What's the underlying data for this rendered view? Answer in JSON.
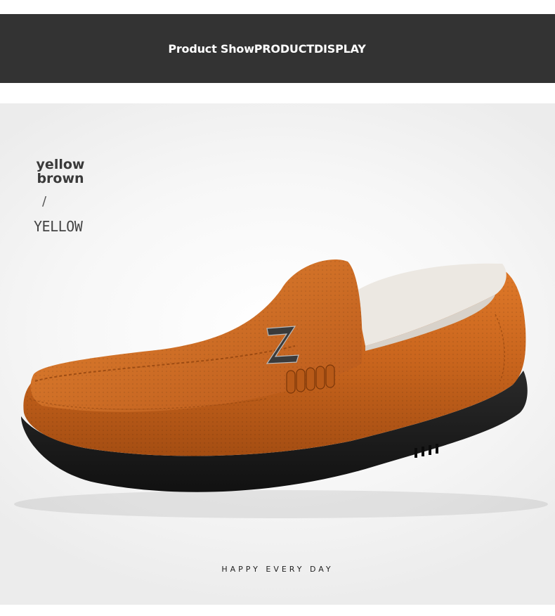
{
  "banner": {
    "title": "Product ShowPRODUCTDISPLAY"
  },
  "color_label": {
    "name_lines": [
      "yellow",
      "brown"
    ],
    "separator": "/",
    "english": "YELLOW"
  },
  "tagline": "HAPPY EVERY DAY",
  "colors": {
    "banner_bg": "#333333",
    "leather": "#c8641e",
    "sole": "#1c1c1c",
    "lining": "#e9e5df"
  }
}
